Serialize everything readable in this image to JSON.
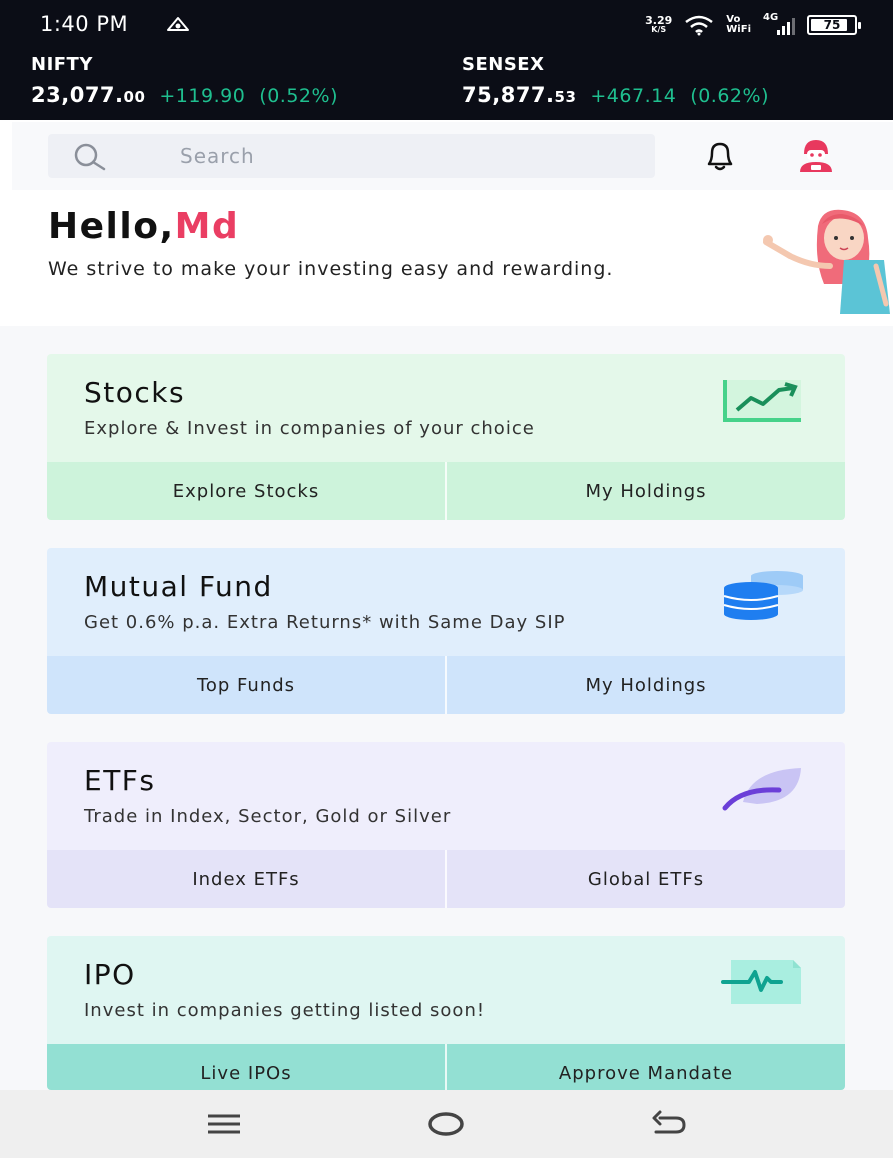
{
  "status_bar": {
    "time": "1:40 PM",
    "speed_value": "3.29",
    "speed_unit": "K/S",
    "vo": "Vo",
    "wifi_label": "WiFi",
    "network": "4G",
    "battery": "75",
    "icons": [
      "hotspot-icon",
      "wifi-icon",
      "signal-icon",
      "battery-icon"
    ]
  },
  "ticker": {
    "nifty": {
      "name": "NIFTY",
      "value_int": "23,077.",
      "value_dec": "00",
      "change": "+119.90",
      "pct": "(0.52%)"
    },
    "sensex": {
      "name": "SENSEX",
      "value_int": "75,877.",
      "value_dec": "53",
      "change": "+467.14",
      "pct": "(0.62%)"
    },
    "positive_color": "#1fbf8f"
  },
  "header": {
    "search_placeholder": "Search",
    "icons": [
      "search-icon",
      "bell-icon",
      "avatar-icon"
    ]
  },
  "greeting": {
    "hello": "Hello,",
    "name": "Md",
    "tagline": "We strive to make your investing easy and rewarding.",
    "name_color": "#ea3e63"
  },
  "cards": {
    "stocks": {
      "title": "Stocks",
      "subtitle": "Explore & Invest in companies of your choice",
      "action_1": "Explore Stocks",
      "action_2": "My Holdings",
      "icon": "chart-trend-icon",
      "color": "#e4f8ea"
    },
    "mutual_fund": {
      "title": "Mutual Fund",
      "subtitle": "Get 0.6% p.a. Extra Returns* with Same Day SIP",
      "action_1": "Top Funds",
      "action_2": "My Holdings",
      "icon": "coins-icon",
      "color": "#e0eefc"
    },
    "etfs": {
      "title": "ETFs",
      "subtitle": "Trade in Index, Sector, Gold or Silver",
      "action_1": "Index ETFs",
      "action_2": "Global ETFs",
      "icon": "leaf-icon",
      "color": "#efeefc"
    },
    "ipo": {
      "title": "IPO",
      "subtitle": "Invest in companies getting listed soon!",
      "action_1": "Live IPOs",
      "action_2": "Approve Mandate",
      "icon": "document-pulse-icon",
      "color": "#dff6f2"
    }
  },
  "navbar": {
    "icons": [
      "menu-icon",
      "home-icon",
      "back-icon"
    ]
  }
}
